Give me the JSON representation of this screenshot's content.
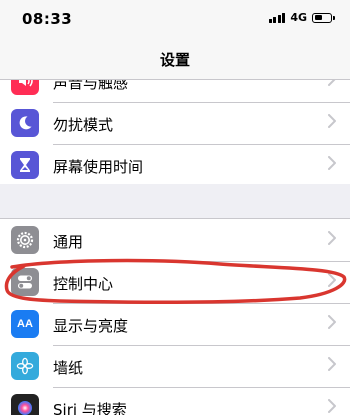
{
  "status_bar": {
    "time": "08:33",
    "network": "4G",
    "battery_level": 0.5
  },
  "nav": {
    "title": "设置"
  },
  "group_top": [
    {
      "label": "声音与触感",
      "icon": "speaker-icon",
      "color": "#ff2d55"
    },
    {
      "label": "勿扰模式",
      "icon": "moon-icon",
      "color": "#5856d6"
    },
    {
      "label": "屏幕使用时间",
      "icon": "hourglass-icon",
      "color": "#5856d6"
    }
  ],
  "group_bottom": [
    {
      "label": "通用",
      "icon": "gear-icon",
      "color": "#8e8e93"
    },
    {
      "label": "控制中心",
      "icon": "toggles-icon",
      "color": "#8e8e93"
    },
    {
      "label": "显示与亮度",
      "icon": "aa-icon",
      "color": "#1a7cf2",
      "icon_text": "AA"
    },
    {
      "label": "墙纸",
      "icon": "flower-icon",
      "color": "#34aadc"
    },
    {
      "label": "Siri 与搜索",
      "icon": "siri-icon",
      "color": "#222222"
    }
  ],
  "annotation_color": "#d9362f"
}
